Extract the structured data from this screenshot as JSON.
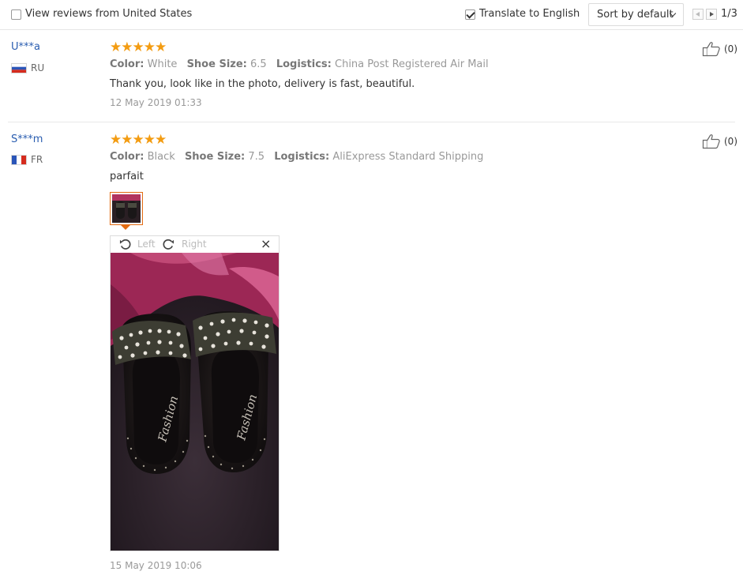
{
  "toolbar": {
    "view_reviews_label": "View reviews from United States",
    "view_reviews_checked": false,
    "translate_label": "Translate to English",
    "translate_checked": true,
    "sort_label": "Sort by default",
    "page_indicator": "1/3"
  },
  "reviews": [
    {
      "user": "U***a",
      "country": "RU",
      "stars": "★★★★★",
      "color_key": "Color:",
      "color_value": "White",
      "size_key": "Shoe Size:",
      "size_value": "6.5",
      "logistics_key": "Logistics:",
      "logistics_value": "China Post Registered Air Mail",
      "text": "Thank you, look like in the photo, delivery is fast, beautiful.",
      "date": "12 May 2019 01:33",
      "useful_count": "(0)"
    },
    {
      "user": "S***m",
      "country": "FR",
      "stars": "★★★★★",
      "color_key": "Color:",
      "color_value": "Black",
      "size_key": "Shoe Size:",
      "size_value": "7.5",
      "logistics_key": "Logistics:",
      "logistics_value": "AliExpress Standard Shipping",
      "text": "parfait",
      "date": "15 May 2019 10:06",
      "useful_count": "(0)"
    }
  ],
  "viewer": {
    "rotate_left_label": "Left",
    "rotate_right_label": "Right",
    "close_symbol": "×",
    "photo_brand_text": "Fashion"
  },
  "colors": {
    "star": "#f39c12",
    "username": "#2a5db0",
    "thumb_border": "#e26b12"
  }
}
